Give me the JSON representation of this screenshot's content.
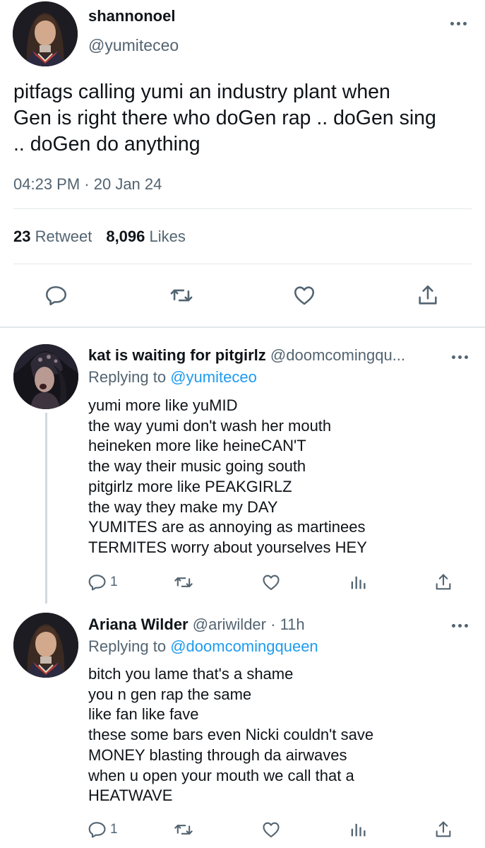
{
  "main_tweet": {
    "name": "shannonoel",
    "handle": "@yumiteceo",
    "text_lines": [
      "pitfags calling yumi an industry plant when",
      "Gen is right there who doGen rap .. doGen sing",
      ".. doGen do anything"
    ],
    "time": "04:23 PM",
    "date": "20 Jan 24",
    "retweet_count": "23",
    "retweet_label": "Retweet",
    "like_count": "8,096",
    "like_label": "Likes"
  },
  "replies": [
    {
      "name": "kat is waiting for pitgirlz",
      "handle": "@doomcomingqu...",
      "replying_label": "Replying to",
      "replying_to": "@yumiteceo",
      "text_lines": [
        "yumi more like yuMID",
        "the way yumi don't wash her mouth",
        "heineken more like heineCAN'T",
        "the way their music going south",
        "pitgirlz more like PEAKGIRLZ",
        "the way they make my DAY",
        "YUMITES are as annoying as martinees",
        "TERMITES worry about yourselves HEY"
      ],
      "reply_count": "1"
    },
    {
      "name": "Ariana Wilder",
      "handle": "@ariwilder",
      "time": "11h",
      "replying_label": "Replying to",
      "replying_to": "@doomcomingqueen",
      "text_lines": [
        "bitch you lame that's a shame",
        "you n gen rap the same",
        "like fan like fave",
        "these some bars even Nicki couldn't save",
        "MONEY blasting through da airwaves",
        "when u open your mouth we call that a",
        "HEATWAVE"
      ],
      "reply_count": "1"
    }
  ],
  "colors": {
    "text": "#0f1419",
    "secondary": "#536471",
    "link": "#1d9bf0",
    "divider": "#e3e7ea"
  },
  "icons": [
    "more-icon",
    "reply-icon",
    "retweet-icon",
    "like-icon",
    "share-icon",
    "analytics-icon"
  ]
}
